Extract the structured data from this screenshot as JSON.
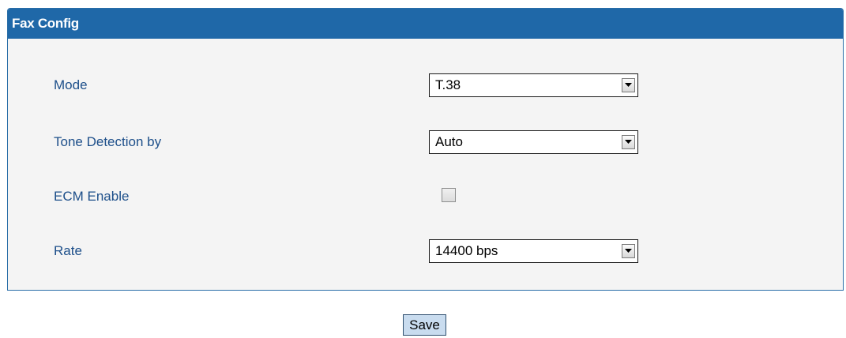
{
  "panel": {
    "title": "Fax Config"
  },
  "fields": {
    "mode": {
      "label": "Mode",
      "value": "T.38"
    },
    "tone_detection": {
      "label": "Tone Detection by",
      "value": "Auto"
    },
    "ecm": {
      "label": "ECM Enable",
      "checked": false
    },
    "rate": {
      "label": "Rate",
      "value": "14400 bps"
    }
  },
  "actions": {
    "save_label": "Save"
  },
  "icons": {
    "select_arrow": "chevron-down-icon"
  },
  "colors": {
    "header_bg": "#1f68a8",
    "label_text": "#1d4f8a",
    "button_bg": "#c9dcef"
  }
}
